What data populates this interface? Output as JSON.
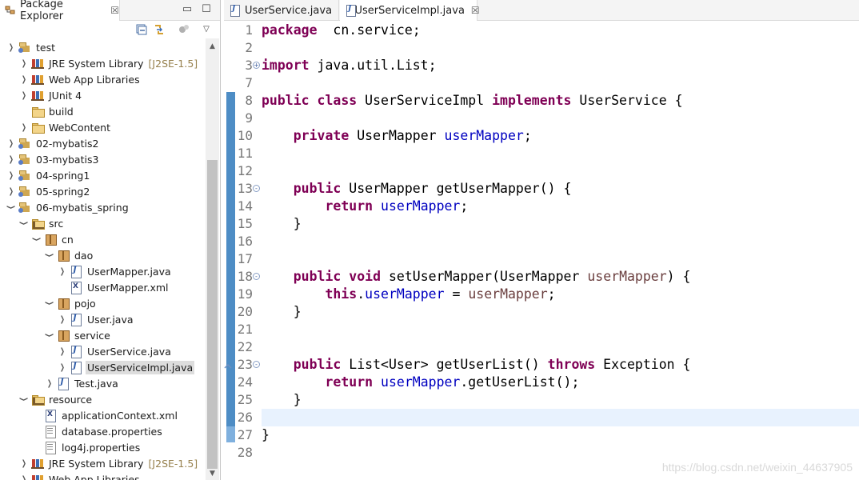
{
  "explorer": {
    "title": "Package Explorer",
    "tree": [
      {
        "label": "test",
        "icon": "project-icon",
        "indent": 0,
        "chevron": "collapsed",
        "tops": 1
      },
      {
        "label": "JRE System Library",
        "deco": "[J2SE-1.5]",
        "icon": "library-icon",
        "indent": 1,
        "chevron": "collapsed"
      },
      {
        "label": "Web App Libraries",
        "icon": "library-icon",
        "indent": 1,
        "chevron": "collapsed"
      },
      {
        "label": "JUnit 4",
        "icon": "library-icon",
        "indent": 1,
        "chevron": "collapsed"
      },
      {
        "label": "build",
        "icon": "folder-icon",
        "indent": 1,
        "chevron": "none"
      },
      {
        "label": "WebContent",
        "icon": "folder-icon",
        "indent": 1,
        "chevron": "collapsed"
      },
      {
        "label": "02-mybatis2",
        "icon": "project-icon",
        "indent": 0,
        "chevron": "collapsed"
      },
      {
        "label": "03-mybatis3",
        "icon": "project-icon",
        "indent": 0,
        "chevron": "collapsed"
      },
      {
        "label": "04-spring1",
        "icon": "project-icon",
        "indent": 0,
        "chevron": "collapsed"
      },
      {
        "label": "05-spring2",
        "icon": "project-icon",
        "indent": 0,
        "chevron": "collapsed"
      },
      {
        "label": "06-mybatis_spring",
        "icon": "project-icon",
        "indent": 0,
        "chevron": "expanded"
      },
      {
        "label": "src",
        "icon": "source-folder-icon",
        "indent": 1,
        "chevron": "expanded"
      },
      {
        "label": "cn",
        "icon": "package-icon",
        "indent": 2,
        "chevron": "expanded"
      },
      {
        "label": "dao",
        "icon": "package-icon",
        "indent": 3,
        "chevron": "expanded"
      },
      {
        "label": "UserMapper.java",
        "icon": "java-file-icon",
        "indent": 4,
        "chevron": "collapsed"
      },
      {
        "label": "UserMapper.xml",
        "icon": "xml-file-icon",
        "indent": 4,
        "chevron": "none"
      },
      {
        "label": "pojo",
        "icon": "package-icon",
        "indent": 3,
        "chevron": "expanded"
      },
      {
        "label": "User.java",
        "icon": "java-file-icon",
        "indent": 4,
        "chevron": "collapsed"
      },
      {
        "label": "service",
        "icon": "package-icon",
        "indent": 3,
        "chevron": "expanded"
      },
      {
        "label": "UserService.java",
        "icon": "java-file-icon",
        "indent": 4,
        "chevron": "collapsed"
      },
      {
        "label": "UserServiceImpl.java",
        "icon": "java-file-icon",
        "indent": 4,
        "chevron": "collapsed",
        "selected": true
      },
      {
        "label": "Test.java",
        "icon": "java-file-icon",
        "indent": 3,
        "chevron": "collapsed"
      },
      {
        "label": "resource",
        "icon": "source-folder-icon",
        "indent": 1,
        "chevron": "expanded"
      },
      {
        "label": "applicationContext.xml",
        "icon": "xml-file-icon",
        "indent": 2,
        "chevron": "none"
      },
      {
        "label": "database.properties",
        "icon": "properties-file-icon",
        "indent": 2,
        "chevron": "none"
      },
      {
        "label": "log4j.properties",
        "icon": "properties-file-icon",
        "indent": 2,
        "chevron": "none"
      },
      {
        "label": "JRE System Library",
        "deco": "[J2SE-1.5]",
        "icon": "library-icon",
        "indent": 1,
        "chevron": "collapsed"
      },
      {
        "label": "Web App Libraries",
        "icon": "library-icon",
        "indent": 1,
        "chevron": "collapsed"
      }
    ]
  },
  "editor": {
    "tabs": [
      {
        "label": "UserService.java",
        "active": false
      },
      {
        "label": "*UserServiceImpl.java",
        "active": true
      }
    ],
    "lines": [
      {
        "num": "1",
        "tokens": [
          [
            "kw",
            "package"
          ],
          [
            "",
            "  cn.service;"
          ]
        ]
      },
      {
        "num": "2",
        "tokens": []
      },
      {
        "num": "3",
        "fold": "+",
        "tokens": [
          [
            "kw",
            "import"
          ],
          [
            "",
            " java.util.List;"
          ]
        ]
      },
      {
        "num": "7",
        "tokens": []
      },
      {
        "num": "8",
        "tokens": [
          [
            "kw",
            "public"
          ],
          [
            "",
            " "
          ],
          [
            "kw",
            "class"
          ],
          [
            "",
            " UserServiceImpl "
          ],
          [
            "kw",
            "implements"
          ],
          [
            "",
            " UserService {"
          ]
        ]
      },
      {
        "num": "9",
        "tokens": []
      },
      {
        "num": "10",
        "tokens": [
          [
            "",
            "    "
          ],
          [
            "kw",
            "private"
          ],
          [
            "",
            " UserMapper "
          ],
          [
            "fld",
            "userMapper"
          ],
          [
            "",
            ";"
          ]
        ]
      },
      {
        "num": "11",
        "tokens": []
      },
      {
        "num": "12",
        "tokens": []
      },
      {
        "num": "13",
        "fold": "-",
        "tokens": [
          [
            "",
            "    "
          ],
          [
            "kw",
            "public"
          ],
          [
            "",
            " UserMapper getUserMapper() {"
          ]
        ]
      },
      {
        "num": "14",
        "tokens": [
          [
            "",
            "        "
          ],
          [
            "kw",
            "return"
          ],
          [
            "",
            " "
          ],
          [
            "fld",
            "userMapper"
          ],
          [
            "",
            ";"
          ]
        ]
      },
      {
        "num": "15",
        "tokens": [
          [
            "",
            "    }"
          ]
        ]
      },
      {
        "num": "16",
        "tokens": []
      },
      {
        "num": "17",
        "tokens": []
      },
      {
        "num": "18",
        "fold": "-",
        "tokens": [
          [
            "",
            "    "
          ],
          [
            "kw",
            "public"
          ],
          [
            "",
            " "
          ],
          [
            "kw",
            "void"
          ],
          [
            "",
            " setUserMapper(UserMapper "
          ],
          [
            "par",
            "userMapper"
          ],
          [
            "",
            ") {"
          ]
        ]
      },
      {
        "num": "19",
        "tokens": [
          [
            "",
            "        "
          ],
          [
            "kw",
            "this"
          ],
          [
            "",
            "."
          ],
          [
            "fld",
            "userMapper"
          ],
          [
            "",
            " = "
          ],
          [
            "par",
            "userMapper"
          ],
          [
            "",
            ";"
          ]
        ]
      },
      {
        "num": "20",
        "tokens": [
          [
            "",
            "    }"
          ]
        ]
      },
      {
        "num": "21",
        "tokens": []
      },
      {
        "num": "22",
        "tokens": []
      },
      {
        "num": "23",
        "fold": "-",
        "warn": true,
        "tokens": [
          [
            "",
            "    "
          ],
          [
            "kw",
            "public"
          ],
          [
            "",
            " List<User> getUserList() "
          ],
          [
            "kw",
            "throws"
          ],
          [
            "",
            " Exception {"
          ]
        ]
      },
      {
        "num": "24",
        "tokens": [
          [
            "",
            "        "
          ],
          [
            "kw",
            "return"
          ],
          [
            "",
            " "
          ],
          [
            "fld",
            "userMapper"
          ],
          [
            "",
            ".getUserList();"
          ]
        ]
      },
      {
        "num": "25",
        "tokens": [
          [
            "",
            "    }"
          ]
        ]
      },
      {
        "num": "26",
        "current": true,
        "tokens": []
      },
      {
        "num": "27",
        "tokens": [
          [
            "",
            "}"
          ]
        ]
      },
      {
        "num": "28",
        "tokens": []
      }
    ]
  },
  "watermark": "https://blog.csdn.net/weixin_44637905"
}
